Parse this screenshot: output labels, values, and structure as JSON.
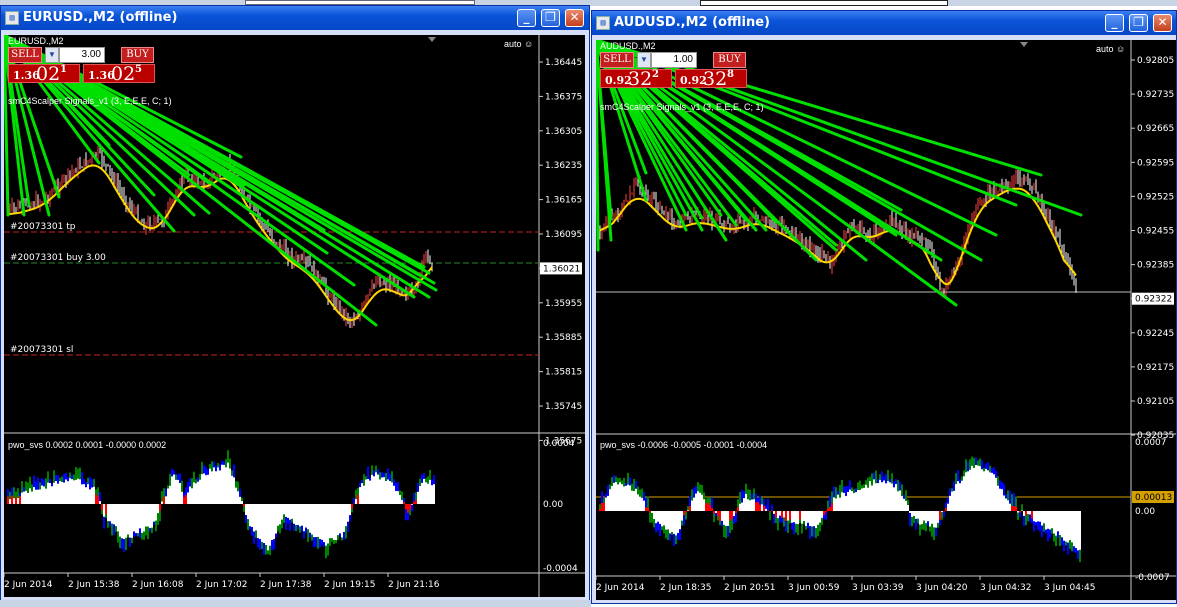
{
  "windows": [
    {
      "title": "EURUSD.,M2 (offline)",
      "symbol_label": "EURUSD.,M2",
      "auto_label": "auto",
      "trade_panel": {
        "sell_label": "SELL",
        "buy_label": "BUY",
        "volume": "3.00",
        "bid": {
          "big": "1.36",
          "pips": "02",
          "point": "1"
        },
        "ask": {
          "big": "1.36",
          "pips": "02",
          "point": "5"
        }
      },
      "indicator_label": "smC4Scalper Signals_v1 (3, E,E,E, C; 1)",
      "order_lines": [
        {
          "label": "#20073301 tp",
          "price": 1.36062
        },
        {
          "label": "#20073301 buy 3.00",
          "price": 1.36021
        },
        {
          "label": "#20073301 sl",
          "price": 1.3583
        }
      ],
      "price_ticks": [
        "1.36445",
        "1.36375",
        "1.36305",
        "1.36235",
        "1.36165",
        "1.36095",
        "1.36021",
        "1.35955",
        "1.35885",
        "1.35815",
        "1.35745",
        "1.35675"
      ],
      "current_price": "1.36021",
      "sub_label": "pwo_svs 0.0002 0.0001 -0.0000 0.0002",
      "sub_ticks": [
        "0.0004",
        "0.00",
        "-0.0004"
      ],
      "time_labels": [
        "2 Jun 2014",
        "2 Jun 15:38",
        "2 Jun 16:08",
        "2 Jun 17:02",
        "2 Jun 17:38",
        "2 Jun 19:15",
        "2 Jun 21:16"
      ]
    },
    {
      "title": "AUDUSD.,M2 (offline)",
      "symbol_label": "AUDUSD.,M2",
      "auto_label": "auto",
      "trade_panel": {
        "sell_label": "SELL",
        "buy_label": "BUY",
        "volume": "1.00",
        "bid": {
          "big": "0.92",
          "pips": "32",
          "point": "2"
        },
        "ask": {
          "big": "0.92",
          "pips": "32",
          "point": "8"
        }
      },
      "indicator_label": "smC4Scalper Signals_v1 (3, E,E,E, C; 1)",
      "order_lines": [],
      "price_ticks": [
        "0.92805",
        "0.92735",
        "0.92665",
        "0.92595",
        "0.92525",
        "0.92455",
        "0.92385",
        "0.92322",
        "0.92245",
        "0.92175",
        "0.92105",
        "0.92035"
      ],
      "current_price": "0.92322",
      "sub_label": "pwo_svs -0.0006 -0.0005 -0.0001 -0.0004",
      "sub_ticks": [
        "0.0007",
        "0.00013",
        "0.00",
        "-0.0007"
      ],
      "sub_current": "0.00013",
      "time_labels": [
        "2 Jun 2014",
        "2 Jun 18:35",
        "2 Jun 20:51",
        "3 Jun 00:59",
        "3 Jun 03:39",
        "3 Jun 04:20",
        "3 Jun 04:32",
        "3 Jun 04:45"
      ]
    }
  ],
  "colors": {
    "title_gradient": "#0a54d8",
    "chart_bg": "#000000",
    "signal_line": "#00e000",
    "ma_line": "#ffd700",
    "order_line": "#cc2222",
    "histo_up": "#ffffff",
    "histo_red": "#ff0000",
    "histo_blue": "#0000ff",
    "histo_green": "#008000"
  },
  "icons": [
    "chart-window-icon",
    "minimize-icon",
    "restore-icon",
    "close-icon",
    "dropdown-arrow-icon",
    "smiley-icon"
  ]
}
